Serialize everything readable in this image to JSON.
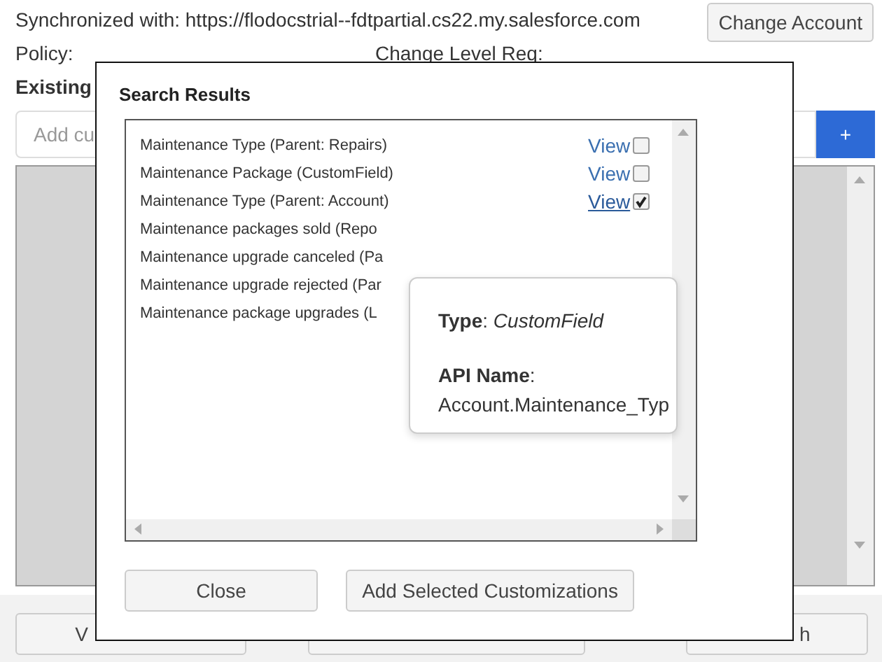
{
  "background": {
    "sync_text": "Synchronized with: https://flodocstrial--fdtpartial.cs22.my.salesforce.com",
    "change_account": "Change Account",
    "policy": "Policy:",
    "change_level": "Change Level Req:",
    "existing": "Existing",
    "add_placeholder": "Add cu",
    "add_button": "+",
    "bottom_buttons": [
      {
        "kind": "labeled",
        "text": "V"
      },
      {
        "kind": "blank"
      },
      {
        "kind": "labeled",
        "text": "h"
      }
    ]
  },
  "dialog": {
    "title": "Search Results",
    "results": [
      {
        "label": "Maintenance Type (Parent: Repairs)",
        "link": "View",
        "hovered": false,
        "checked": false
      },
      {
        "label": "Maintenance Package (CustomField)",
        "link": "View",
        "hovered": false,
        "checked": false
      },
      {
        "label": "Maintenance Type (Parent: Account)",
        "link": "View",
        "hovered": true,
        "checked": true
      },
      {
        "label": "Maintenance packages sold (Repo"
      },
      {
        "label": "Maintenance upgrade canceled (Pa"
      },
      {
        "label": "Maintenance upgrade rejected (Par"
      },
      {
        "label": "Maintenance package upgrades (L"
      }
    ],
    "popover": {
      "type_line": "**Type**: *CustomField*",
      "api_label": "**API Name**:",
      "api_value": "Account.Maintenance_Typ"
    },
    "buttons": [
      "Close",
      "Add Selected Customizations"
    ]
  }
}
